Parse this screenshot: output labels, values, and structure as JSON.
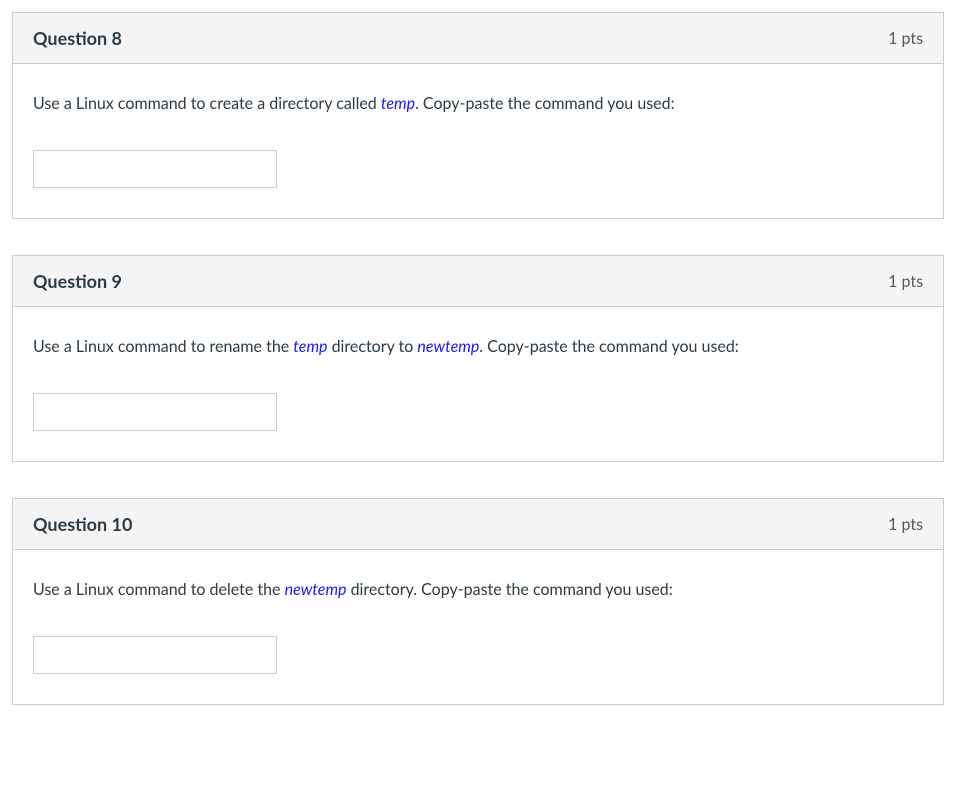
{
  "questions": [
    {
      "title": "Question 8",
      "points": "1 pts",
      "prompt_segments": [
        {
          "text": "Use a Linux command to create a directory called ",
          "em": false
        },
        {
          "text": "temp",
          "em": true
        },
        {
          "text": ". Copy-paste the command you used:",
          "em": false
        }
      ],
      "answer_value": ""
    },
    {
      "title": "Question 9",
      "points": "1 pts",
      "prompt_segments": [
        {
          "text": "Use a Linux command to rename the ",
          "em": false
        },
        {
          "text": "temp",
          "em": true
        },
        {
          "text": " directory to ",
          "em": false
        },
        {
          "text": "newtemp",
          "em": true
        },
        {
          "text": ". Copy-paste the command you used:",
          "em": false
        }
      ],
      "answer_value": ""
    },
    {
      "title": "Question 10",
      "points": "1 pts",
      "prompt_segments": [
        {
          "text": "Use a Linux command to delete the ",
          "em": false
        },
        {
          "text": "newtemp",
          "em": true
        },
        {
          "text": " directory. Copy-paste the command you used:",
          "em": false
        }
      ],
      "answer_value": ""
    }
  ]
}
